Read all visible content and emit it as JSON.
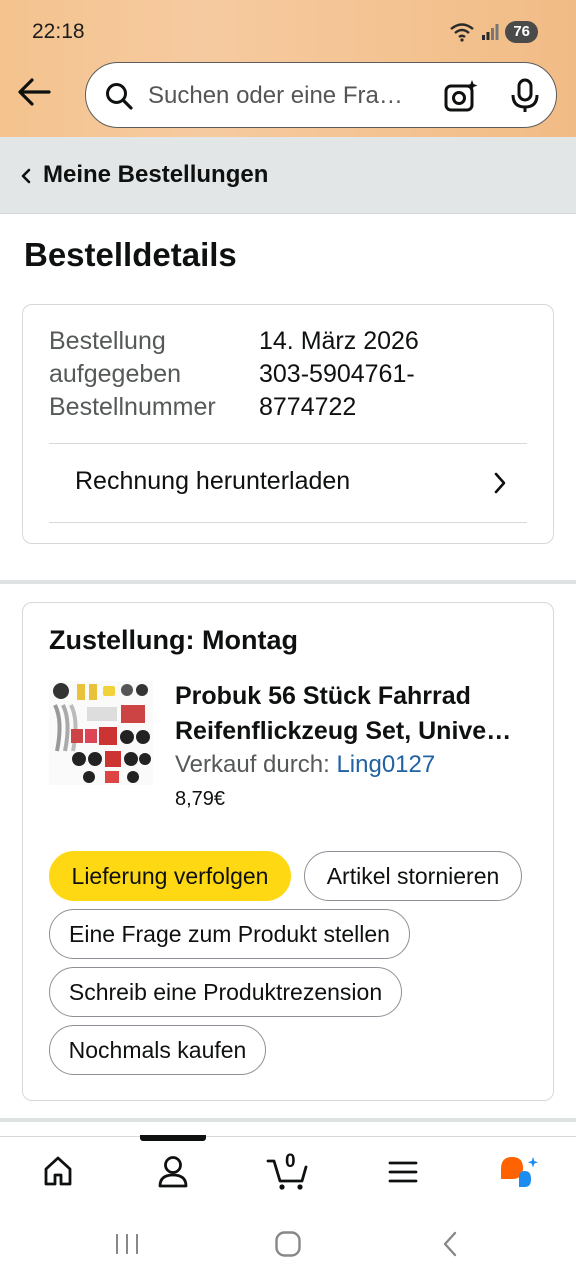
{
  "status_bar": {
    "time": "22:18",
    "battery": "76",
    "icons": [
      "wifi-icon",
      "signal-icon"
    ]
  },
  "search": {
    "placeholder": "Suchen oder eine Fra…"
  },
  "breadcrumb": {
    "label": "Meine Bestellungen"
  },
  "page": {
    "title": "Bestelldetails"
  },
  "order_info": {
    "placed_label_line1": "Bestellung",
    "placed_label_line2": "aufgegeben",
    "placed_value": "14. März 2026",
    "number_label": "Bestellnummer",
    "number_value_line1": "303-5904761-",
    "number_value_line2": "8774722",
    "invoice_label": "Rechnung herunterladen"
  },
  "delivery": {
    "title": "Zustellung: Montag",
    "product_title_line1": "Probuk 56 Stück Fahrrad",
    "product_title_line2": "Reifenflickzeug Set, Unive…",
    "seller_prefix": "Verkauf durch: ",
    "seller_name": "Ling0127",
    "price": "8,79€",
    "buttons": {
      "track": "Lieferung verfolgen",
      "cancel": "Artikel stornieren",
      "ask": "Eine Frage zum Produkt stellen",
      "review": "Schreib eine Produktrezension",
      "buy_again": "Nochmals kaufen"
    }
  },
  "bottom_nav": {
    "cart_count": "0",
    "items": [
      "home-icon",
      "account-icon",
      "cart-icon",
      "menu-icon",
      "rufus-icon"
    ]
  },
  "colors": {
    "header_bg": "#f4c38e",
    "primary_button": "#ffd814",
    "link": "#2162a1",
    "accent_orange": "#ff6200",
    "accent_blue": "#1c8cf0"
  }
}
